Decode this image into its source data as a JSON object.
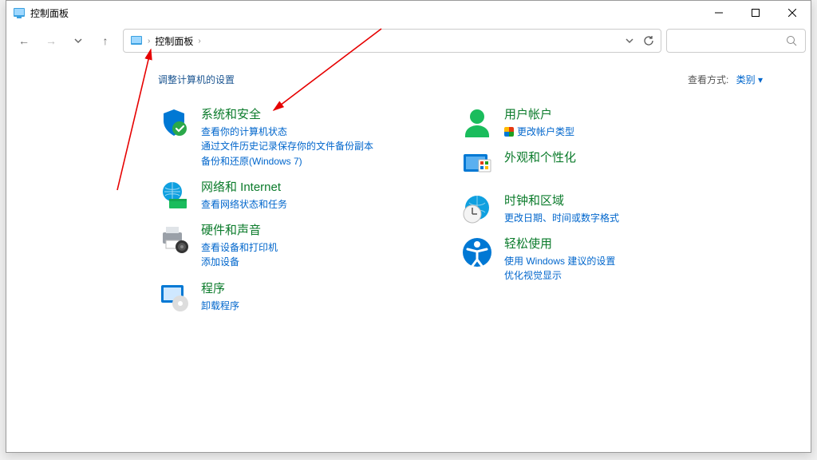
{
  "window": {
    "title": "控制面板"
  },
  "breadcrumb": {
    "root": "控制面板"
  },
  "page": {
    "heading": "调整计算机的设置",
    "view_label": "查看方式:",
    "view_value": "类别"
  },
  "left_cats": [
    {
      "title": "系统和安全",
      "links": [
        "查看你的计算机状态",
        "通过文件历史记录保存你的文件备份副本",
        "备份和还原(Windows 7)"
      ],
      "icon": "shield"
    },
    {
      "title": "网络和 Internet",
      "links": [
        "查看网络状态和任务"
      ],
      "icon": "globe"
    },
    {
      "title": "硬件和声音",
      "links": [
        "查看设备和打印机",
        "添加设备"
      ],
      "icon": "printer"
    },
    {
      "title": "程序",
      "links": [
        "卸载程序"
      ],
      "icon": "programs"
    }
  ],
  "right_cats": [
    {
      "title": "用户帐户",
      "links": [
        "更改帐户类型"
      ],
      "shielded": [
        true
      ],
      "icon": "user"
    },
    {
      "title": "外观和个性化",
      "links": [],
      "icon": "appearance"
    },
    {
      "title": "时钟和区域",
      "links": [
        "更改日期、时间或数字格式"
      ],
      "icon": "clock"
    },
    {
      "title": "轻松使用",
      "links": [
        "使用 Windows 建议的设置",
        "优化视觉显示"
      ],
      "icon": "ease"
    }
  ]
}
